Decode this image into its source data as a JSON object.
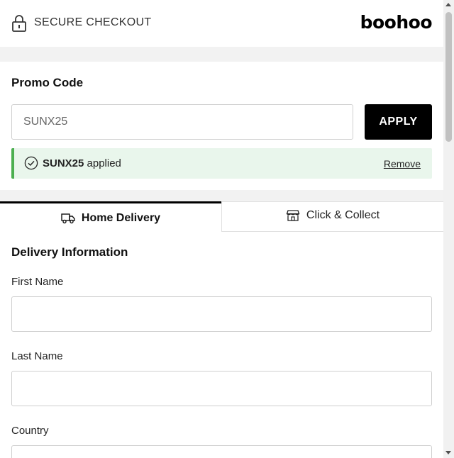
{
  "header": {
    "secure_label": "SECURE CHECKOUT",
    "brand": "boohoo",
    "lock_icon": "lock-icon"
  },
  "promo": {
    "title": "Promo Code",
    "input_value": "SUNX25",
    "apply_label": "APPLY",
    "applied": {
      "code": "SUNX25",
      "suffix": " applied",
      "remove_label": "Remove",
      "icon": "check-circle-icon",
      "accent_color": "#4caf50",
      "background_color": "#e9f6ec"
    }
  },
  "tabs": [
    {
      "label": "Home Delivery",
      "icon": "delivery-truck-icon",
      "active": true
    },
    {
      "label": "Click & Collect",
      "icon": "store-icon",
      "active": false
    }
  ],
  "delivery": {
    "title": "Delivery Information",
    "fields": [
      {
        "label": "First Name",
        "value": ""
      },
      {
        "label": "Last Name",
        "value": ""
      },
      {
        "label": "Country",
        "value": ""
      }
    ]
  },
  "colors": {
    "primary_button": "#000000",
    "band_background": "#f2f2f2"
  }
}
